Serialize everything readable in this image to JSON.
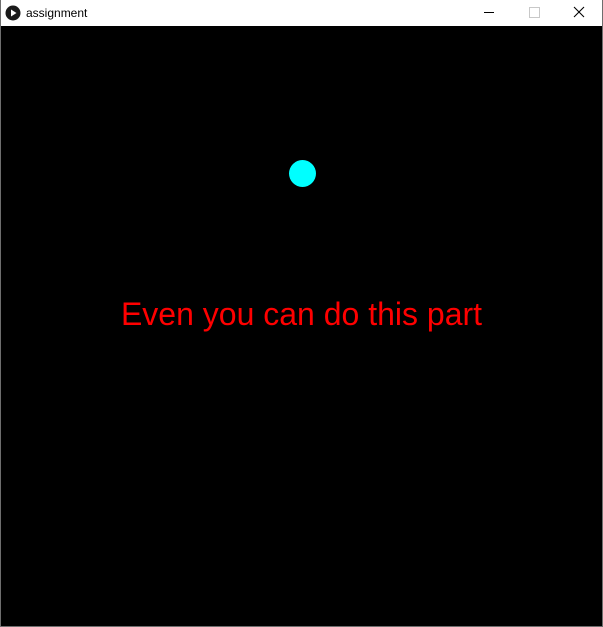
{
  "window": {
    "title": "assignment",
    "app_icon": "play-icon",
    "controls": {
      "minimize_icon": "minimize-icon",
      "maximize_icon": "maximize-icon",
      "close_icon": "close-icon"
    }
  },
  "sketch": {
    "background_color": "#000000",
    "ball_color": "#00ffff",
    "message": "Even you can do this part",
    "message_color": "#ff0000"
  }
}
